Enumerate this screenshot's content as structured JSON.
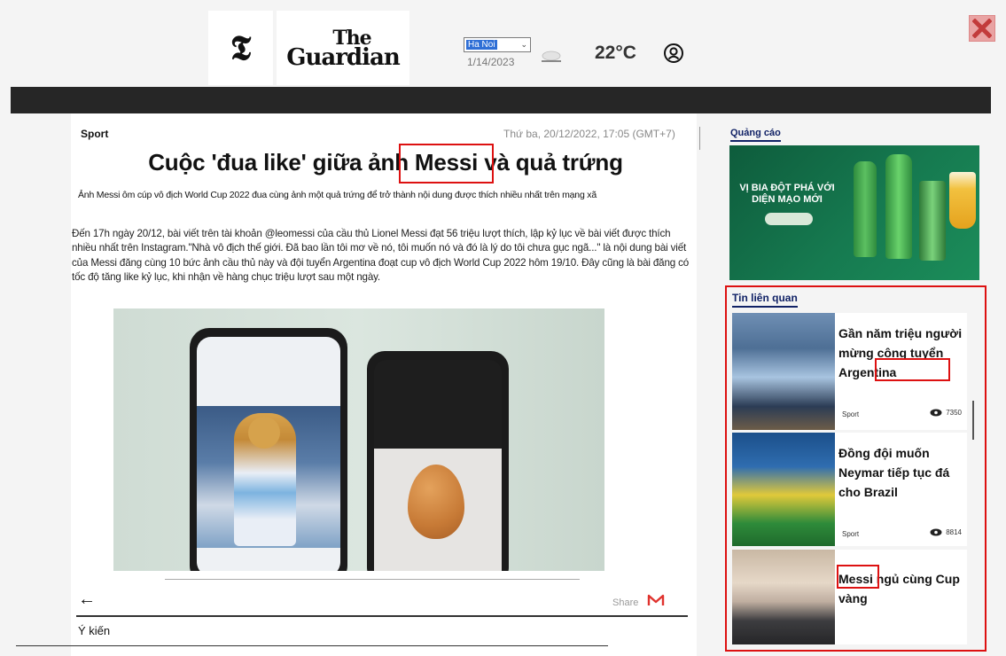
{
  "header": {
    "logo_nyt": "𝕿",
    "logo_guardian_line1": "The",
    "logo_guardian_line2": "Guardian",
    "city_select": "Ha Noi",
    "date": "1/14/2023",
    "temperature": "22°C"
  },
  "article": {
    "category": "Sport",
    "timestamp": "Thứ ba, 20/12/2022, 17:05 (GMT+7)",
    "title": "Cuộc 'đua like' giữa ảnh Messi và quả trứng",
    "summary": "Ảnh Messi ôm cúp vô địch World Cup 2022 đua cùng ảnh một quả trứng để trở thành nội dung được thích nhiều nhất trên mạng xã",
    "body": "Đến 17h ngày 20/12, bài viết trên tài khoản @leomessi của cầu thủ Lionel Messi đạt 56 triệu lượt thích, lập kỷ lục về bài viết được thích nhiều nhất trên Instagram.\"Nhà vô địch thế giới. Đã bao lần tôi mơ về nó, tôi muốn nó và đó là lý do tôi chưa gục ngã...\" là nội dung bài viết của Messi đăng cùng 10 bức ảnh cầu thủ này và đội tuyển Argentina đoạt cup vô địch World Cup 2022 hôm 19/10. Đây cũng là bài đăng có tốc độ tăng like kỷ lục, khi nhận về hàng chục triệu lượt sau một ngày.",
    "share_label": "Share",
    "comments_label": "Ý kiến"
  },
  "sidebar": {
    "ad_label": "Quảng cáo",
    "ad_text": "VỊ BIA ĐỘT PHÁ VỚI DIỆN MẠO MỚI",
    "related_label": "Tin liên quan",
    "related": [
      {
        "title": "Gần năm triệu người mừng công tuyển Argentina",
        "category": "Sport",
        "views": "7350"
      },
      {
        "title": "Đồng đội muốn Neymar tiếp tục đá cho Brazil",
        "category": "Sport",
        "views": "8814"
      },
      {
        "title": "Messi ngủ cùng Cup vàng",
        "category": "",
        "views": ""
      }
    ]
  },
  "colors": {
    "highlight": "#dd1111",
    "dark_bar": "#262626",
    "sidebar_label": "#112266"
  }
}
